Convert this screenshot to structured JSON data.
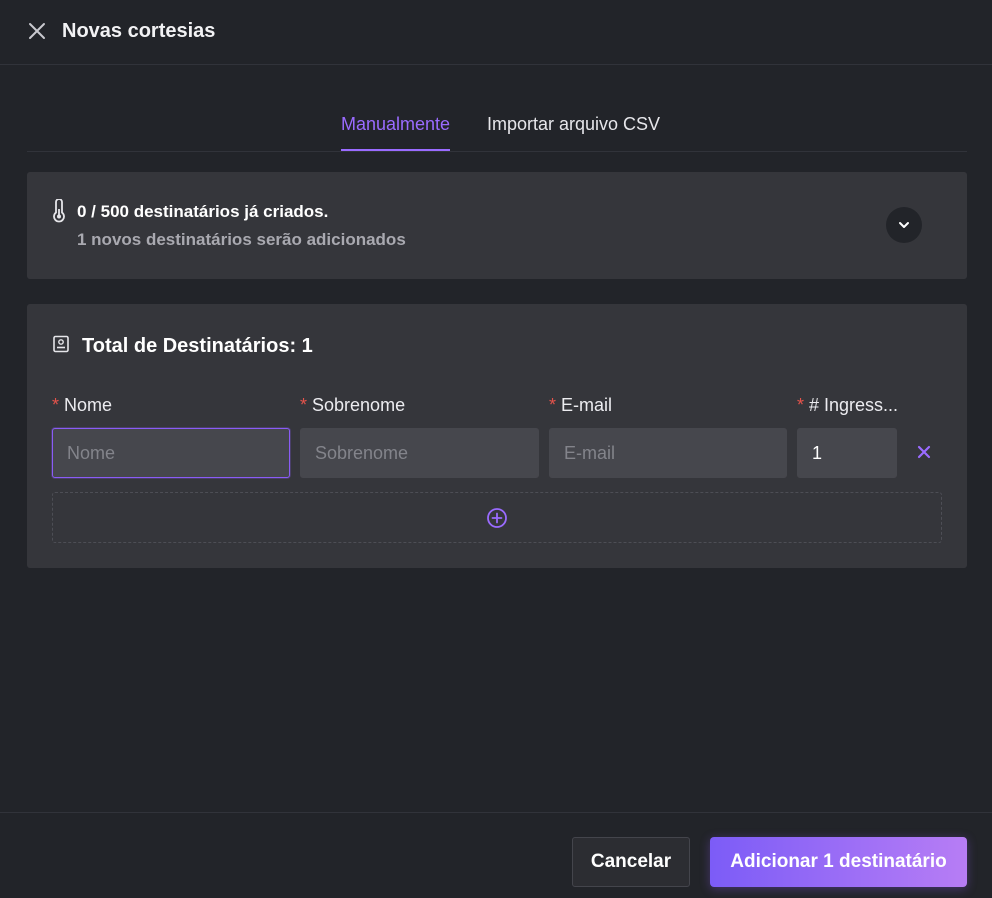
{
  "header": {
    "title": "Novas cortesias",
    "close_icon": "close-icon"
  },
  "tabs": [
    {
      "label": "Manualmente",
      "active": true
    },
    {
      "label": "Importar arquivo CSV",
      "active": false
    }
  ],
  "info": {
    "icon": "thermometer-icon",
    "created_text": "0 / 500 destinatários já criados.",
    "new_text": "1 novos destinatários serão adicionados",
    "expand_icon": "chevron-down-icon"
  },
  "form": {
    "icon": "contact-card-icon",
    "total_label": "Total de Destinatários: 1",
    "required_marker": "*",
    "fields": [
      {
        "label": "Nome",
        "placeholder": "Nome",
        "value": ""
      },
      {
        "label": "Sobrenome",
        "placeholder": "Sobrenome",
        "value": ""
      },
      {
        "label": "E-mail",
        "placeholder": "E-mail",
        "value": ""
      },
      {
        "label": "# Ingress...",
        "placeholder": "",
        "value": "1"
      }
    ],
    "remove_icon": "close-icon",
    "add_icon": "plus-circle-icon"
  },
  "footer": {
    "cancel_label": "Cancelar",
    "submit_label": "Adicionar 1 destinatário"
  },
  "colors": {
    "background": "#222429",
    "card": "#35363b",
    "accent": "#9a6bff",
    "required": "#e5534b",
    "gradient_start": "#7c5cf7",
    "gradient_end": "#b77df5"
  }
}
